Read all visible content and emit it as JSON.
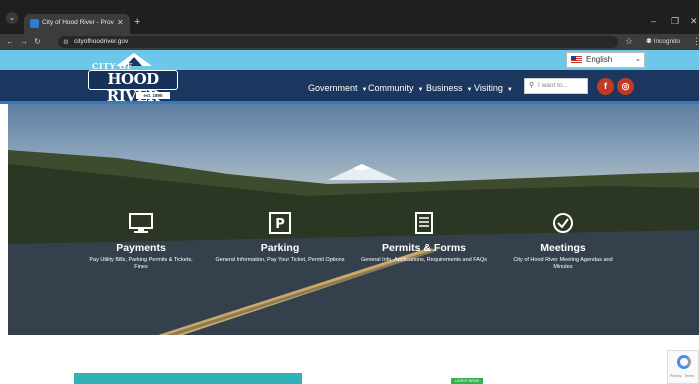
{
  "browser": {
    "tab_title": "City of Hood River - Providing",
    "url": "cityofhoodriver.gov",
    "profile_label": "Incognito"
  },
  "header": {
    "logo_top": "CITY OF",
    "logo_name": "HOOD RIVER",
    "logo_est": "est. 1895",
    "language": "English",
    "nav": [
      {
        "label": "Government"
      },
      {
        "label": "Community"
      },
      {
        "label": "Business"
      },
      {
        "label": "Visiting"
      }
    ],
    "search_placeholder": "I want to..."
  },
  "features": [
    {
      "title": "Payments",
      "desc": "Pay Utility Bills, Parking Permits & Tickets, Fines",
      "icon": "payments-monitor-icon"
    },
    {
      "title": "Parking",
      "desc": "General Information, Pay Your Ticket, Permit Options",
      "icon": "parking-icon"
    },
    {
      "title": "Permits & Forms",
      "desc": "General Info, Applications, Requirements and FAQs",
      "icon": "permits-form-icon"
    },
    {
      "title": "Meetings",
      "desc": "City of Hood River Meeting Agendas and Minutes",
      "icon": "meetings-check-icon"
    }
  ],
  "below": {
    "badge": "LATEST NEWS"
  },
  "recaptcha_text": "Privacy - Terms",
  "colors": {
    "header_navy": "#1b3760",
    "header_sky": "#6cc7ea",
    "accent_red": "#c03a26",
    "teal": "#2fb3b6"
  }
}
